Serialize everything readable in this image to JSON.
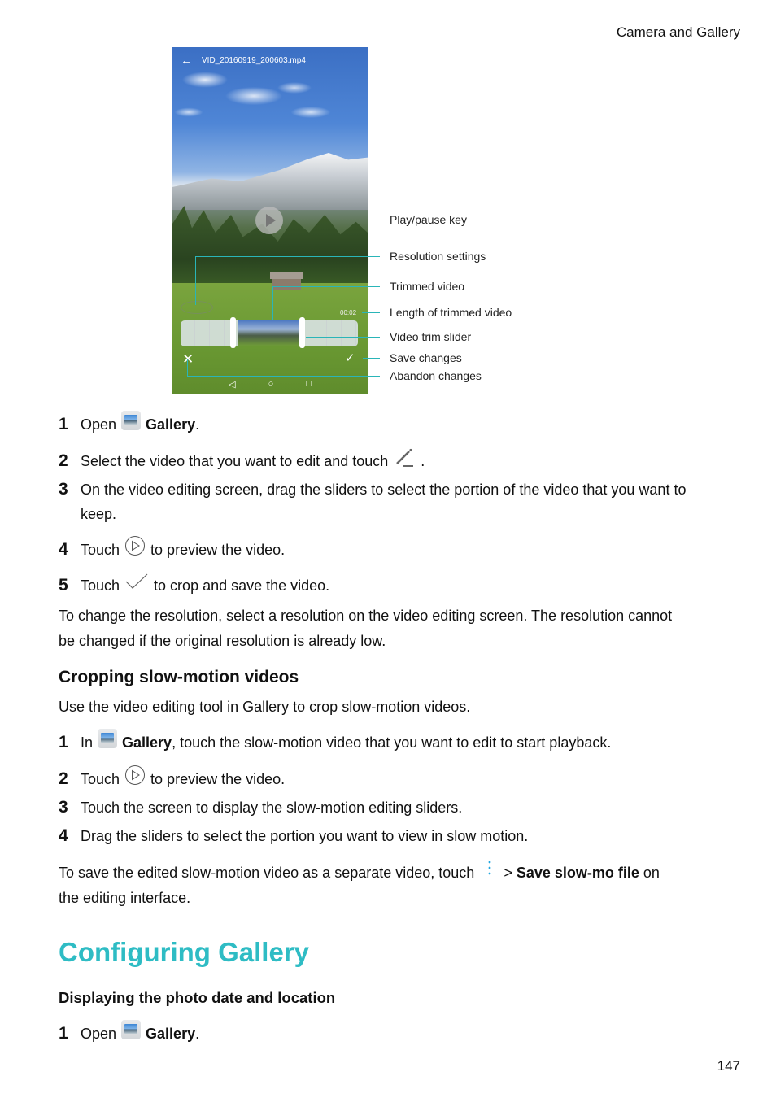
{
  "header": {
    "chapter": "Camera and Gallery"
  },
  "page_number": "147",
  "phone_screen": {
    "filename": "VID_20160919_200603.mp4",
    "duration": "00:02",
    "accent_color": "#2ab5b8"
  },
  "callouts": [
    {
      "label": "Play/pause key"
    },
    {
      "label": "Resolution settings"
    },
    {
      "label": "Trimmed video"
    },
    {
      "label": "Length of trimmed video"
    },
    {
      "label": "Video trim slider"
    },
    {
      "label": "Save changes"
    },
    {
      "label": "Abandon changes"
    }
  ],
  "steps_edit": [
    {
      "num": "1",
      "pre": "Open",
      "bold": "Gallery",
      "post": "."
    },
    {
      "num": "2",
      "pre": "Select the video that you want to edit and touch",
      "post": "."
    },
    {
      "num": "3",
      "line1": "On the video editing screen, drag the sliders to select the portion of the video that you want to",
      "line2": "keep."
    },
    {
      "num": "4",
      "pre": "Touch",
      "post": "to preview the video."
    },
    {
      "num": "5",
      "pre": "Touch",
      "post": "to crop and save the video."
    }
  ],
  "resolution_note": {
    "line1": "To change the resolution, select a resolution on the video editing screen. The resolution cannot",
    "line2": "be changed if the original resolution is already low."
  },
  "slowmo_section": {
    "heading": "Cropping slow-motion videos",
    "intro": "Use the video editing tool in Gallery to crop slow-motion videos.",
    "steps": [
      {
        "num": "1",
        "pre": "In",
        "bold": "Gallery",
        "post": ", touch the slow-motion video that you want to edit to start playback."
      },
      {
        "num": "2",
        "pre": "Touch",
        "post": "to preview the video."
      },
      {
        "num": "3",
        "text": "Touch the screen to display the slow-motion editing sliders."
      },
      {
        "num": "4",
        "text": "Drag the sliders to select the portion you want to view in slow motion."
      }
    ],
    "note": {
      "pre": "To save the edited slow-motion video as a separate video, touch",
      "sep": ">",
      "bold": "Save slow-mo file",
      "post": "on",
      "line2": "the editing interface."
    }
  },
  "configuring": {
    "title": "Configuring Gallery",
    "title_color": "#2ebcc4",
    "subheading": "Displaying the photo date and location",
    "steps": [
      {
        "num": "1",
        "pre": "Open",
        "bold": "Gallery",
        "post": "."
      }
    ]
  }
}
